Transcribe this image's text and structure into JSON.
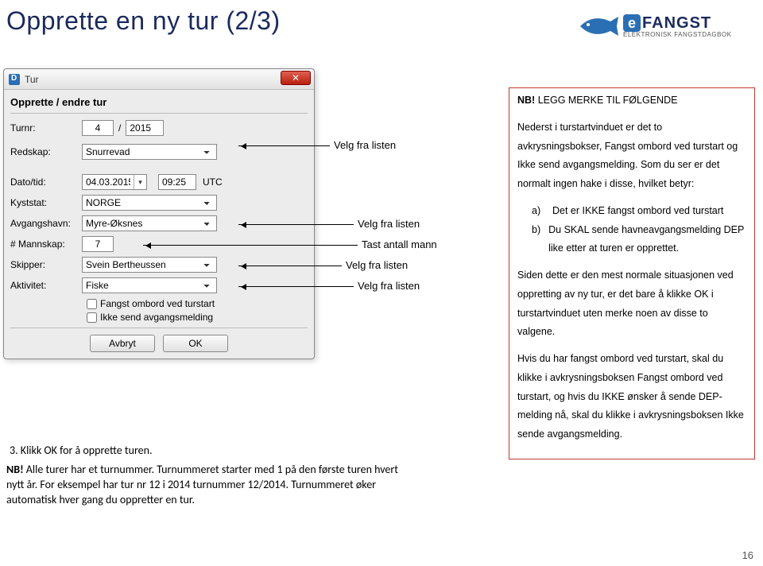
{
  "page": {
    "title": "Opprette en ny tur (2/3)",
    "number": "16"
  },
  "logo": {
    "e": "e",
    "brand": "FANGST",
    "sub": "ELEKTRONISK FANGSTDAGBOK"
  },
  "dialog": {
    "title": "Tur",
    "section": "Opprette / endre tur",
    "labels": {
      "turnr": "Turnr:",
      "redskap": "Redskap:",
      "datotid": "Dato/tid:",
      "kyststat": "Kyststat:",
      "avgangshavn": "Avgangshavn:",
      "mannskap": "# Mannskap:",
      "skipper": "Skipper:",
      "aktivitet": "Aktivitet:"
    },
    "values": {
      "turnr_num": "4",
      "turnr_year": "2015",
      "redskap": "Snurrevad",
      "dato": "04.03.2015",
      "tid": "09:25",
      "tz": "UTC",
      "kyststat": "NORGE",
      "avgangshavn": "Myre-Øksnes",
      "mannskap": "7",
      "skipper": "Svein Bertheussen",
      "aktivitet": "Fiske"
    },
    "checks": {
      "fangst_ombord": "Fangst ombord ved turstart",
      "ikke_send": "Ikke send avgangsmelding"
    },
    "buttons": {
      "cancel": "Avbryt",
      "ok": "OK"
    }
  },
  "annotations": {
    "a1": "Velg fra listen",
    "a2": "Velg fra listen",
    "a3": "Tast antall mann",
    "a4": "Velg fra listen",
    "a5": "Velg fra listen"
  },
  "note": {
    "p1_bold": "NB!",
    "p1_rest": " LEGG MERKE TIL FØLGENDE",
    "p2": "Nederst i turstartvinduet er det to avkrysningsbokser, Fangst ombord ved turstart og Ikke send avgangsmelding. Som du ser er det  normalt ingen hake i disse, hvilket betyr:",
    "a_lab": "a)",
    "a_txt": "Det er IKKE fangst ombord ved turstart",
    "b_lab": "b)",
    "b_txt": "Du SKAL sende havneavgangsmelding DEP like etter at turen er opprettet.",
    "p3": "Siden dette er den mest normale situasjonen ved oppretting av ny tur, er det bare å klikke OK i turstartvinduet uten merke noen av disse to valgene.",
    "p4": "Hvis du har fangst ombord ved turstart, skal du klikke i avkrysningsboksen Fangst ombord ved turstart, og hvis du IKKE ønsker å sende DEP-melding nå, skal du klikke i avkrysningsboksen Ikke sende avgangsmelding."
  },
  "bottom": {
    "step": "3. Klikk OK for å opprette turen.",
    "nb_bold": "NB!",
    "nb_rest": " Alle turer har et turnummer. Turnummeret starter med 1 på den første turen hvert nytt år. For eksempel har tur nr 12 i 2014 turnummer 12/2014. Turnummeret øker automatisk hver gang du oppretter en tur."
  }
}
